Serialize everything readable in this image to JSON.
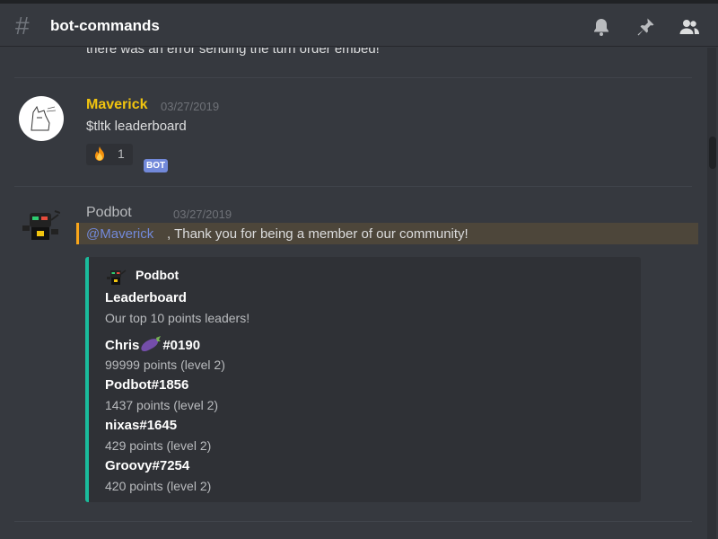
{
  "header": {
    "channel_name": "bot-commands",
    "icons": [
      "hash-icon",
      "bell-icon",
      "pin-icon",
      "members-icon"
    ]
  },
  "messages": {
    "prev_line": "there was an error sending the turn order embed!",
    "maverick": {
      "username": "Maverick",
      "username_color": "#f1c40f",
      "timestamp": "03/27/2019",
      "content": "$tltk leaderboard",
      "reaction": {
        "emoji": "fire-emoji",
        "count": "1"
      }
    },
    "podbot": {
      "username": "Podbot",
      "bot_tag": "BOT",
      "timestamp": "03/27/2019",
      "mention": "@Maverick",
      "content": ", Thank you for being a member of our community!",
      "embed": {
        "color": "#1abc9c",
        "author": "Podbot",
        "title": "Leaderboard",
        "description": "Our top 10 points leaders!",
        "fields": [
          {
            "name_pre": "Chris",
            "name_emoji": "eggplant-emoji",
            "name_post": "#0190",
            "value": "99999 points (level 2)"
          },
          {
            "name": "Podbot#1856",
            "value": "1437 points (level 2)"
          },
          {
            "name": "nixas#1645",
            "value": "429 points (level 2)"
          },
          {
            "name": "Groovy#7254",
            "value": "420 points (level 2)"
          }
        ]
      }
    }
  },
  "colors": {
    "background": "#36393f",
    "mention_highlight": "#faa61a",
    "bot_tag": "#7289da",
    "embed_bar": "#1abc9c"
  }
}
